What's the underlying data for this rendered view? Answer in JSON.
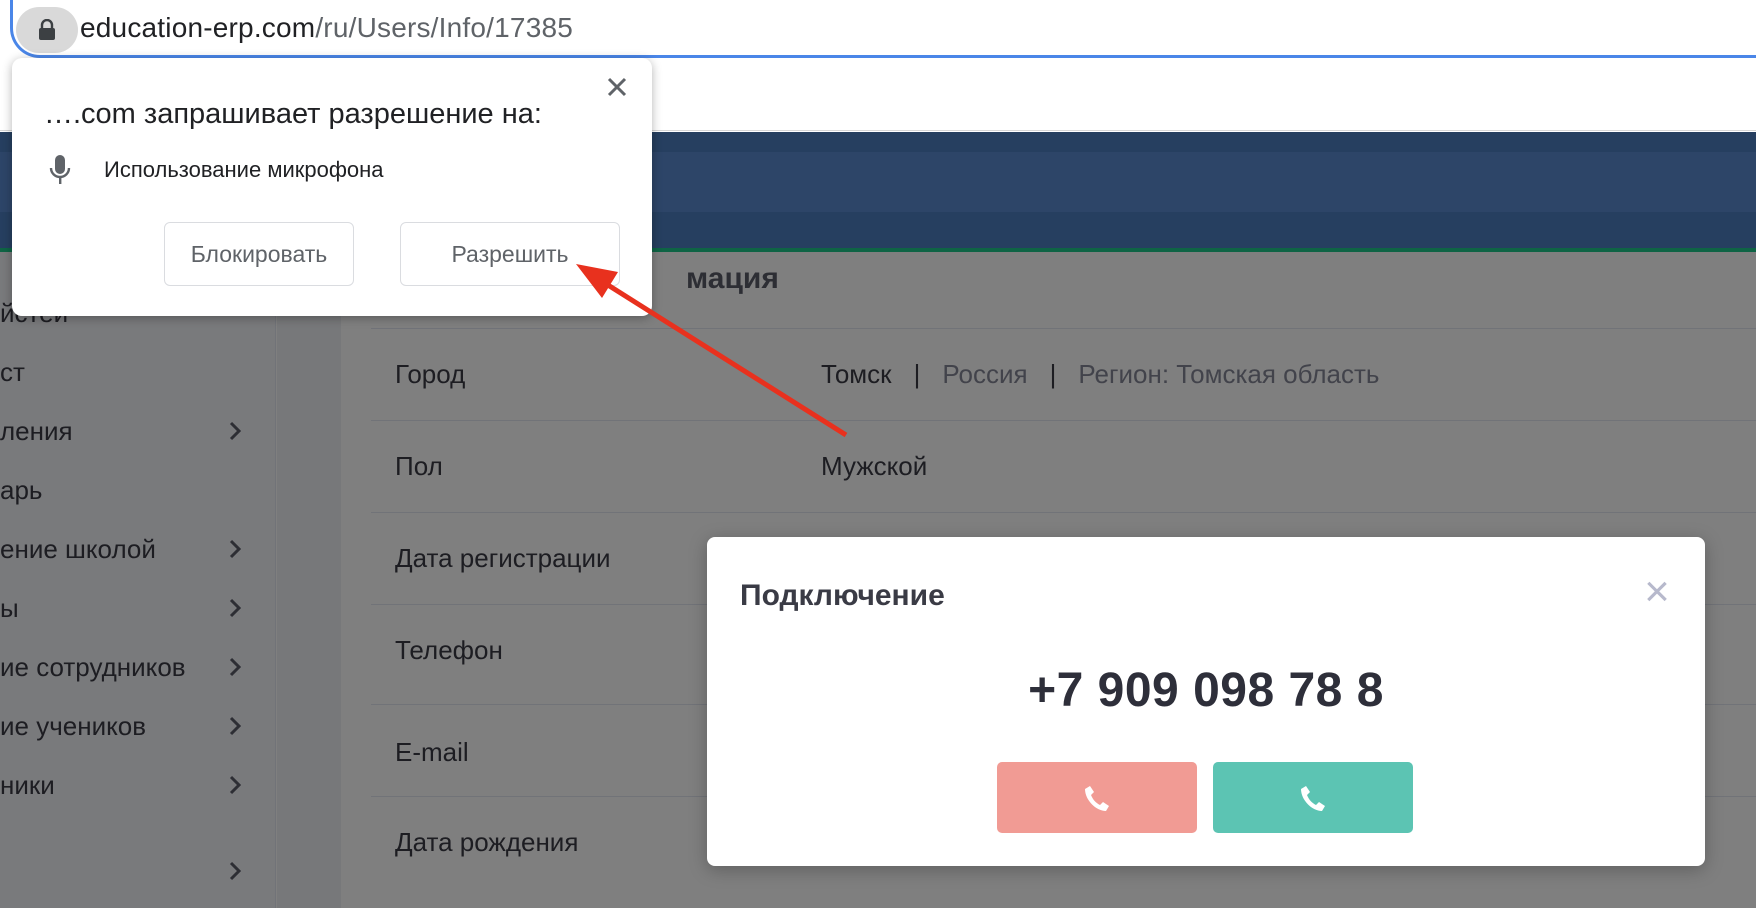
{
  "browser": {
    "url_host": "education-erp.com",
    "url_path": "/ru/Users/Info/17385",
    "lock_icon": "lock-icon"
  },
  "sidebar": {
    "items": [
      {
        "label": "йстеи",
        "has_chevron": false
      },
      {
        "label": "ст",
        "has_chevron": false
      },
      {
        "label": "ления",
        "has_chevron": true
      },
      {
        "label": "арь",
        "has_chevron": false
      },
      {
        "label": "ение школой",
        "has_chevron": true
      },
      {
        "label": "ы",
        "has_chevron": true
      },
      {
        "label": "ие сотрудников",
        "has_chevron": true
      },
      {
        "label": "ие учеников",
        "has_chevron": true
      },
      {
        "label": "ники",
        "has_chevron": true
      }
    ]
  },
  "main": {
    "section_title": "мация",
    "rows": [
      {
        "key": "Город",
        "city": "Томск",
        "country": "Россия",
        "region": "Регион: Томская область"
      },
      {
        "key": "Пол",
        "value": "Мужской"
      },
      {
        "key": "Дата регистрации",
        "value": ""
      },
      {
        "key": "Телефон",
        "value": ""
      },
      {
        "key": "E-mail",
        "value": ""
      },
      {
        "key": "Дата рождения",
        "value": ""
      }
    ]
  },
  "modal": {
    "title": "Подключение",
    "close": "×",
    "phone": "+7 909 098 78 8",
    "decline_icon": "phone-icon",
    "accept_icon": "phone-icon",
    "decline_color": "#f19b94",
    "accept_color": "#5cc4b3"
  },
  "permission": {
    "title": "….com запрашивает разрешение на:",
    "item": "Использование микрофона",
    "block_label": "Блокировать",
    "allow_label": "Разрешить",
    "mic_icon": "microphone-icon",
    "close_icon": "close-icon"
  },
  "annotation": {
    "arrow_color": "#e8311e"
  },
  "colors": {
    "header": "#4d7ec1",
    "accent": "#1cc88a",
    "url_focus": "#4a86e8"
  }
}
